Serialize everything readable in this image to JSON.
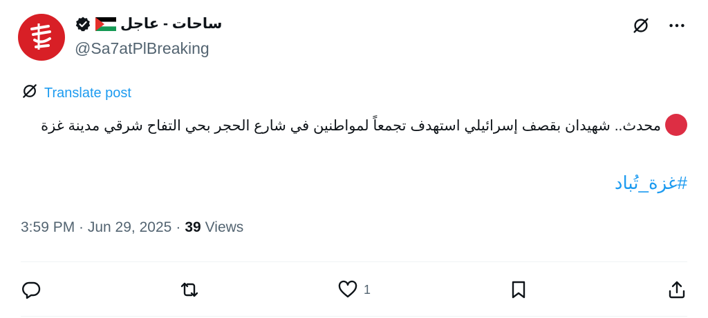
{
  "account": {
    "display_name": "ساحات - عاجل",
    "handle": "@Sa7atPlBreaking",
    "verified": true,
    "flag_icon": "palestine-flag-icon",
    "avatar_color": "#d81f26"
  },
  "translate": {
    "label": "Translate post",
    "icon": "translate-globe-icon",
    "color": "#1d9bf0"
  },
  "post": {
    "text": "محدث.. شهيدان بقصف إسرائيلي استهدف تجمعاً لمواطنين في شارع الحجر بحي التفاح شرقي مدينة غزة",
    "hashtag": "#غزة_تُباد",
    "timestamp": "3:59 PM · Jun 29, 2025",
    "views_count": "39",
    "views_label": "Views"
  },
  "actions": {
    "reply_icon": "reply-icon",
    "repost_icon": "repost-icon",
    "like_icon": "heart-icon",
    "like_count": "1",
    "bookmark_icon": "bookmark-icon",
    "share_icon": "share-icon"
  },
  "top_icons": {
    "grok_icon": "grok-icon",
    "more_icon": "more-icon"
  },
  "colors": {
    "link": "#1d9bf0",
    "muted": "#536471",
    "text": "#0f1419",
    "divider": "#eff3f4"
  }
}
